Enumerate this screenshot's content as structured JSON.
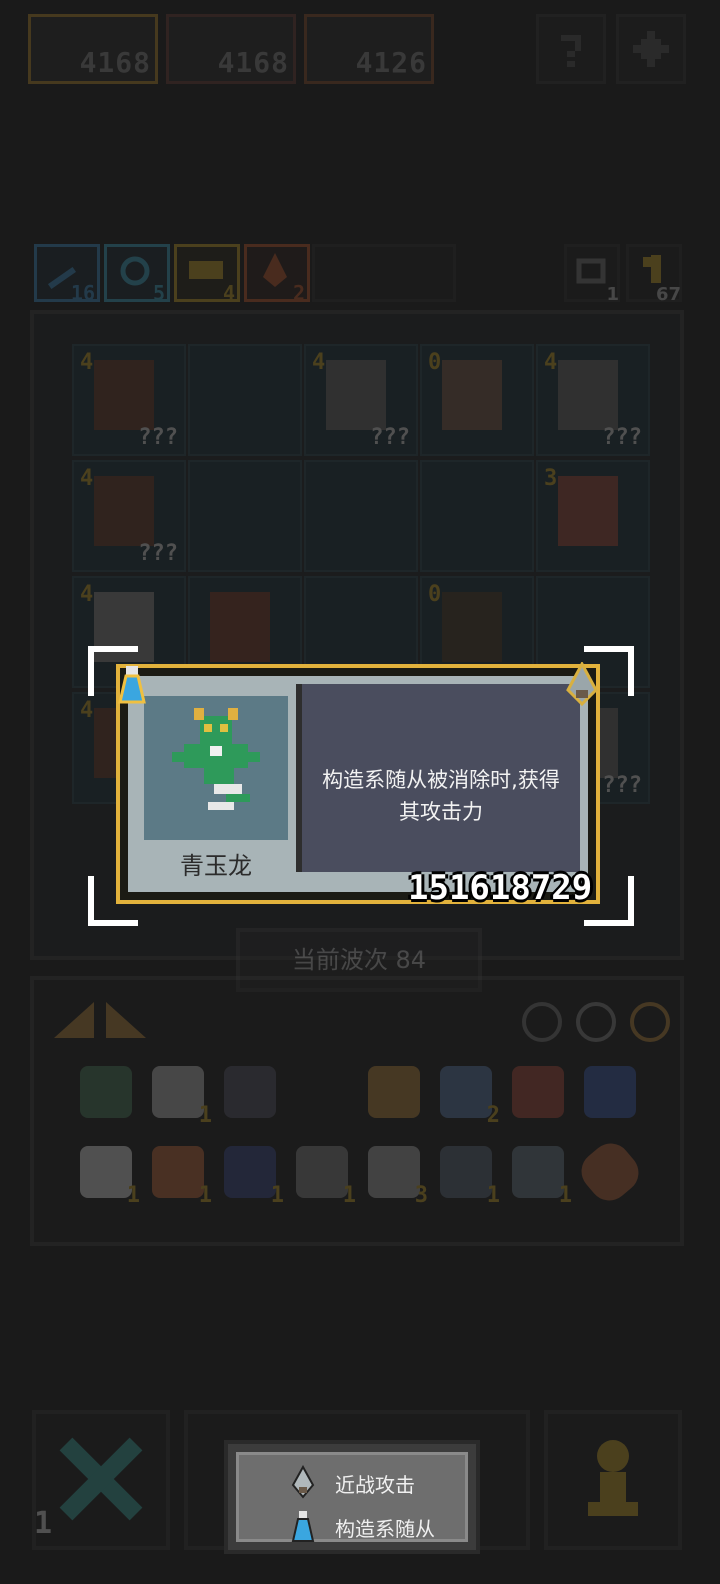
{
  "top_bar": {
    "portraits": [
      {
        "score": "4168",
        "frame_color": "#b88a2a"
      },
      {
        "score": "4168",
        "frame_color": "#6a3a33"
      },
      {
        "score": "4126",
        "frame_color": "#8a4e2a"
      }
    ],
    "help_icon": "help-icon",
    "settings_icon": "gear-icon"
  },
  "stats": [
    {
      "icon": "sword-icon",
      "value": "16",
      "color": "#3a8fc7"
    },
    {
      "icon": "magic-icon",
      "value": "5",
      "color": "#3aa6c7"
    },
    {
      "icon": "gold-icon",
      "value": "4",
      "color": "#c9a227"
    },
    {
      "icon": "flame-icon",
      "value": "2",
      "color": "#c2582a"
    }
  ],
  "right_counters": [
    {
      "icon": "refresh-icon",
      "value": "1"
    },
    {
      "icon": "key-icon",
      "value": "67"
    }
  ],
  "board": {
    "rows": [
      [
        {
          "lvl": "4",
          "tag": "???"
        },
        {
          "lvl": "",
          "tag": ""
        },
        {
          "lvl": "4",
          "tag": "???"
        },
        {
          "lvl": "0",
          "tag": ""
        },
        {
          "lvl": "4",
          "tag": "???"
        }
      ],
      [
        {
          "lvl": "4",
          "tag": "???"
        },
        {
          "lvl": "",
          "tag": ""
        },
        {
          "lvl": "",
          "tag": ""
        },
        {
          "lvl": "",
          "tag": ""
        },
        {
          "lvl": "3",
          "tag": ""
        }
      ],
      [
        {
          "lvl": "4",
          "tag": ""
        },
        {
          "lvl": "",
          "tag": ""
        },
        {
          "lvl": "",
          "tag": ""
        },
        {
          "lvl": "0",
          "tag": ""
        },
        {
          "lvl": "",
          "tag": ""
        }
      ],
      [
        {
          "lvl": "4",
          "tag": ""
        },
        {
          "lvl": "",
          "tag": ""
        },
        {
          "lvl": "",
          "tag": ""
        },
        {
          "lvl": "",
          "tag": ""
        },
        {
          "lvl": "",
          "tag": "???"
        }
      ]
    ]
  },
  "wave": {
    "label": "当前波次 84"
  },
  "inventory": {
    "row1": [
      {
        "count": ""
      },
      {
        "count": "1"
      },
      {
        "count": ""
      },
      {
        "count": ""
      },
      {
        "count": ""
      },
      {
        "count": "2"
      },
      {
        "count": ""
      },
      {
        "count": ""
      }
    ],
    "row2": [
      {
        "count": "1"
      },
      {
        "count": "1"
      },
      {
        "count": "1"
      },
      {
        "count": "1"
      },
      {
        "count": "3"
      },
      {
        "count": "1"
      },
      {
        "count": "1"
      },
      {
        "count": ""
      }
    ]
  },
  "popup": {
    "unit_name": "青玉龙",
    "description": "构造系随从被消除时,获得其攻击力",
    "number": "151618729",
    "frame_color": "#e2b23c"
  },
  "legend": {
    "items": [
      {
        "icon": "melee-icon",
        "label": "近战攻击"
      },
      {
        "icon": "flask-icon",
        "label": "构造系随从"
      }
    ]
  },
  "bottom": {
    "left_counter": "1"
  }
}
